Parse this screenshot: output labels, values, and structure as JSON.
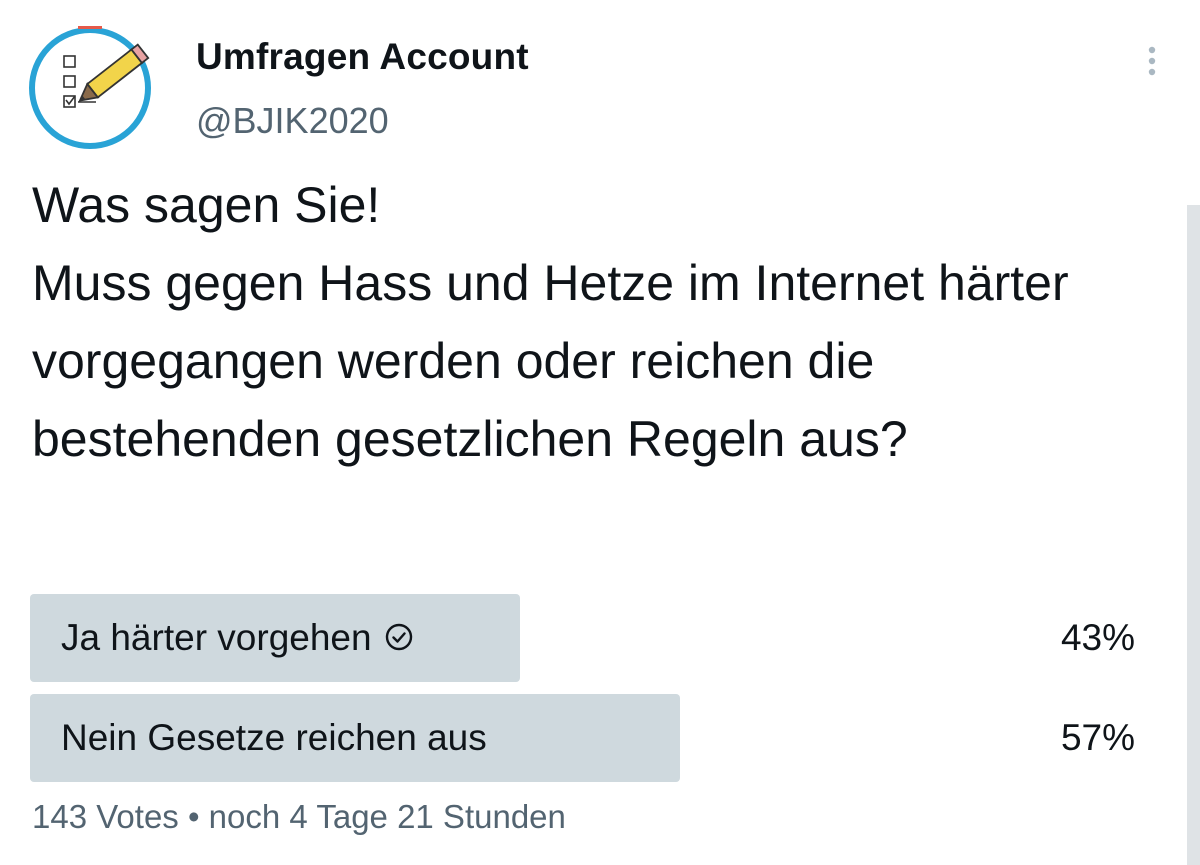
{
  "tweet": {
    "author": {
      "display_name": "Umfragen Account",
      "handle": "@BJIK2020",
      "avatar_icon": "checklist-pencil-icon"
    },
    "more_icon": "more-vertical-icon",
    "text": "Was sagen Sie!\nMuss gegen Hass und Hetze im Internet härter vorgegangen werden oder reichen die bestehenden gesetzlichen Regeln aus?"
  },
  "poll": {
    "options": [
      {
        "label": "Ja härter vorgehen",
        "percent": "43%",
        "fraction": 0.43,
        "voted": true,
        "voted_icon": "check-circle-icon"
      },
      {
        "label": "Nein Gesetze reichen aus",
        "percent": "57%",
        "fraction": 0.57,
        "voted": false
      }
    ],
    "footer": "143 Votes • noch 4 Tage 21 Stunden"
  },
  "colors": {
    "bar": "#cfd9de",
    "text_primary": "#0f1419",
    "text_secondary": "#536471",
    "avatar_ring": "#29a3d6",
    "pencil": "#f2d44a"
  }
}
